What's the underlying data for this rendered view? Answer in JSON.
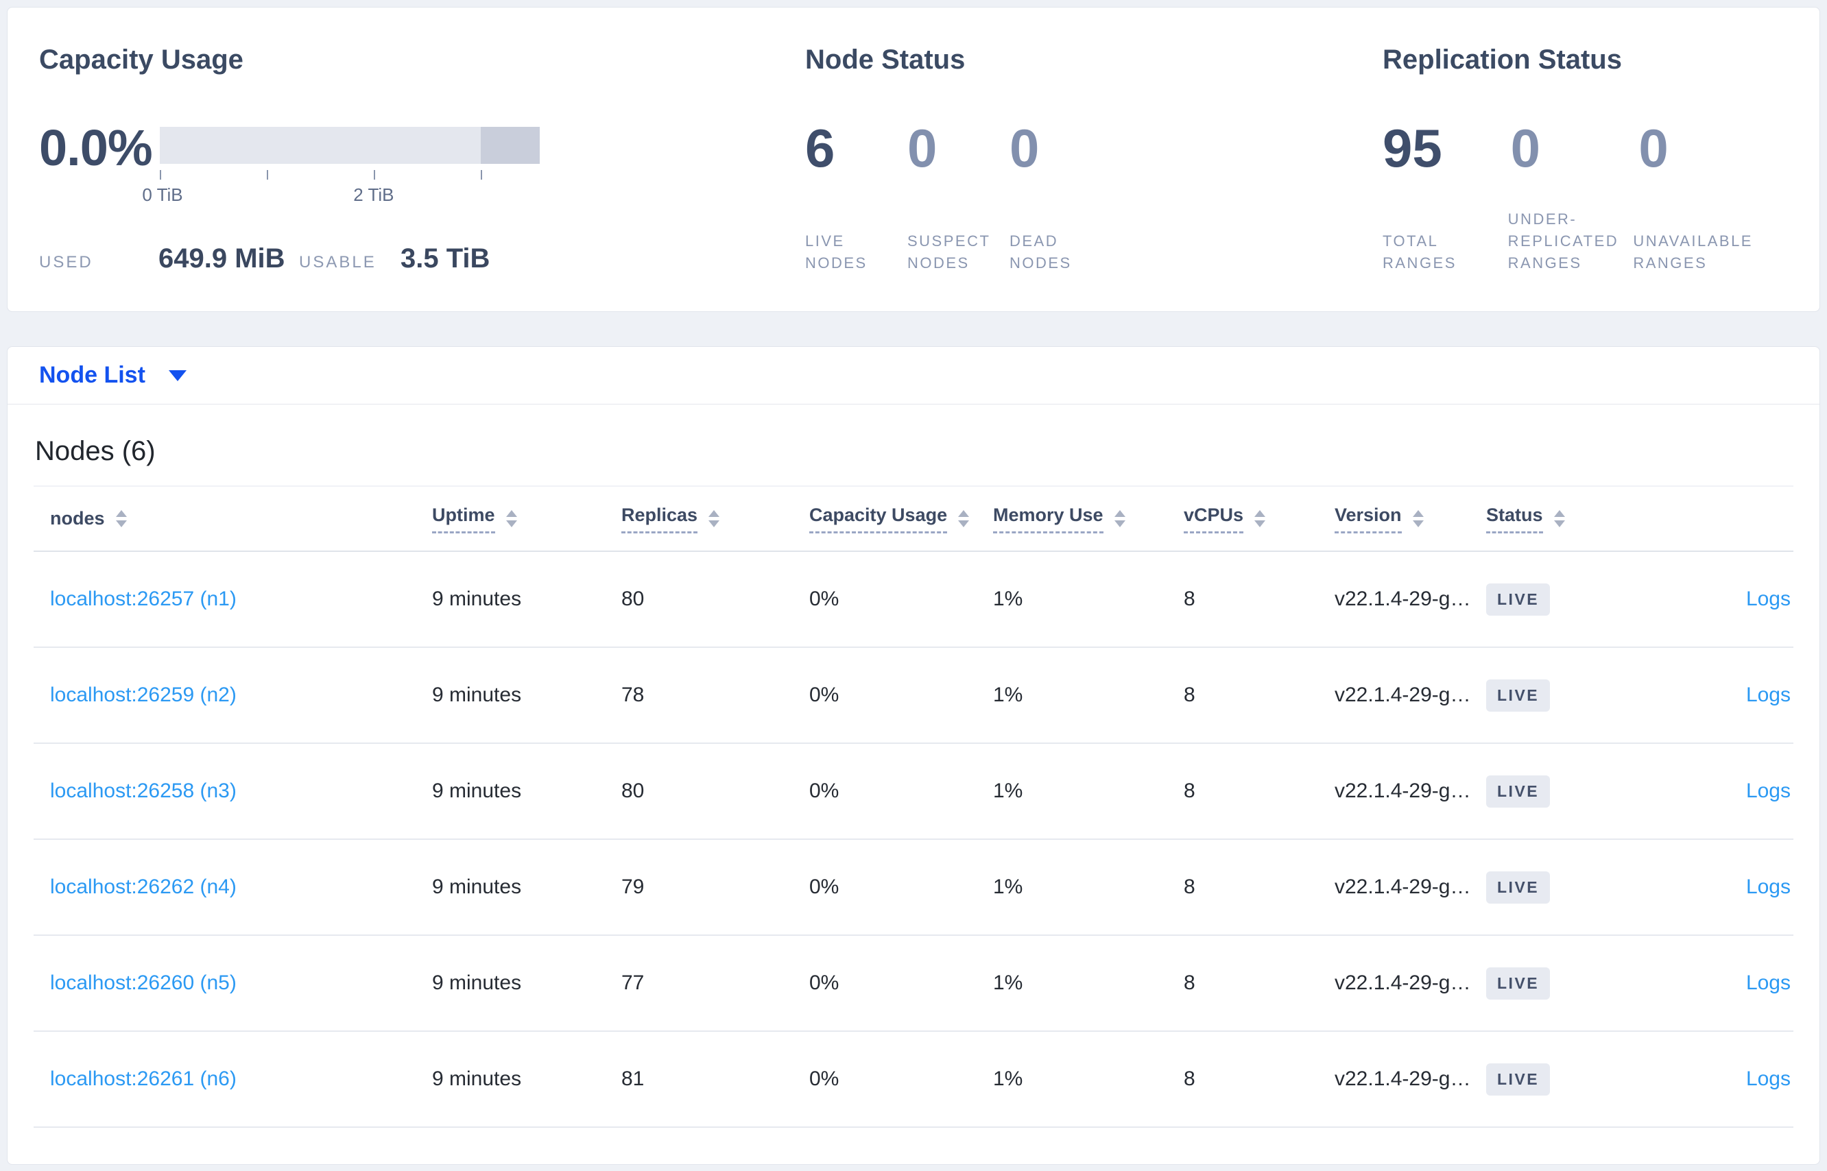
{
  "summary": {
    "capacity": {
      "title": "Capacity Usage",
      "percent": "0.0%",
      "used_label": "USED",
      "used_value": "649.9 MiB",
      "usable_label": "USABLE",
      "usable_value": "3.5 TiB",
      "gauge": {
        "tick_labels": [
          "0 TiB",
          "2 TiB"
        ],
        "tick_values_tib": [
          0,
          1,
          2,
          3
        ],
        "used_fraction": 0.0,
        "usable_tib": 3.5,
        "secondary_segment_start_fraction": 0.845
      }
    },
    "node_status": {
      "title": "Node Status",
      "stats": [
        {
          "value": "6",
          "label": "LIVE NODES"
        },
        {
          "value": "0",
          "label": "SUSPECT NODES"
        },
        {
          "value": "0",
          "label": "DEAD NODES"
        }
      ]
    },
    "replication": {
      "title": "Replication Status",
      "stats": [
        {
          "value": "95",
          "label": "TOTAL RANGES"
        },
        {
          "value": "0",
          "label": "UNDER-REPLICATED RANGES"
        },
        {
          "value": "0",
          "label": "UNAVAILABLE RANGES"
        }
      ]
    }
  },
  "node_list": {
    "selector_label": "Node List"
  },
  "table": {
    "title": "Nodes (6)",
    "logs_label": "Logs",
    "columns": [
      {
        "label": "nodes",
        "dashed": false
      },
      {
        "label": "Uptime",
        "dashed": true
      },
      {
        "label": "Replicas",
        "dashed": true
      },
      {
        "label": "Capacity Usage",
        "dashed": true
      },
      {
        "label": "Memory Use",
        "dashed": true
      },
      {
        "label": "vCPUs",
        "dashed": true
      },
      {
        "label": "Version",
        "dashed": true
      },
      {
        "label": "Status",
        "dashed": true
      },
      {
        "label": "",
        "dashed": false
      }
    ],
    "rows": [
      {
        "address": "localhost:26257 (n1)",
        "uptime": "9 minutes",
        "replicas": "80",
        "capacity_usage": "0%",
        "memory_use": "1%",
        "vcpus": "8",
        "version": "v22.1.4-29-g…",
        "status": "LIVE"
      },
      {
        "address": "localhost:26259 (n2)",
        "uptime": "9 minutes",
        "replicas": "78",
        "capacity_usage": "0%",
        "memory_use": "1%",
        "vcpus": "8",
        "version": "v22.1.4-29-g…",
        "status": "LIVE"
      },
      {
        "address": "localhost:26258 (n3)",
        "uptime": "9 minutes",
        "replicas": "80",
        "capacity_usage": "0%",
        "memory_use": "1%",
        "vcpus": "8",
        "version": "v22.1.4-29-g…",
        "status": "LIVE"
      },
      {
        "address": "localhost:26262 (n4)",
        "uptime": "9 minutes",
        "replicas": "79",
        "capacity_usage": "0%",
        "memory_use": "1%",
        "vcpus": "8",
        "version": "v22.1.4-29-g…",
        "status": "LIVE"
      },
      {
        "address": "localhost:26260 (n5)",
        "uptime": "9 minutes",
        "replicas": "77",
        "capacity_usage": "0%",
        "memory_use": "1%",
        "vcpus": "8",
        "version": "v22.1.4-29-g…",
        "status": "LIVE"
      },
      {
        "address": "localhost:26261 (n6)",
        "uptime": "9 minutes",
        "replicas": "81",
        "capacity_usage": "0%",
        "memory_use": "1%",
        "vcpus": "8",
        "version": "v22.1.4-29-g…",
        "status": "LIVE"
      }
    ]
  },
  "colors": {
    "page_background": "#eef1f6",
    "panel_background": "#ffffff",
    "panel_border": "#e1e5ec",
    "heading_text": "#3b4a63",
    "stat_primary": "#3f4e6b",
    "stat_muted": "#8290ae",
    "micro_label": "#8a96b0",
    "gauge_track": "#e4e7ee",
    "gauge_segment": "#c9cedb",
    "table_link_blue": "#2b99f3",
    "selector_blue": "#1352ef",
    "badge_background": "#e7eaf1",
    "badge_text": "#44506a"
  }
}
